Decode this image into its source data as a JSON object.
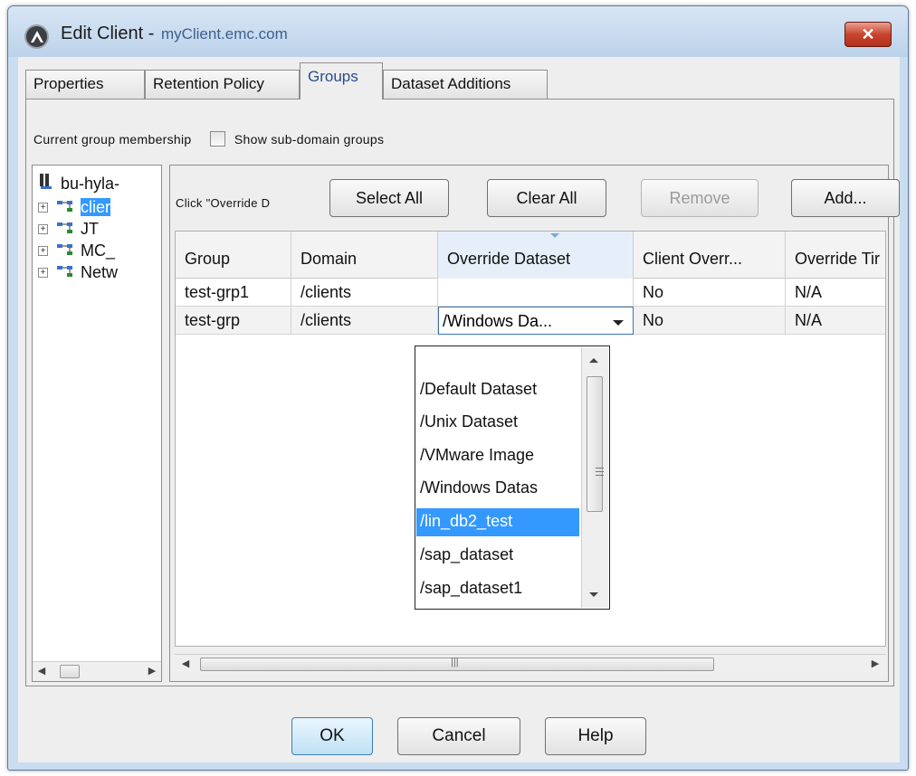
{
  "window": {
    "title": "Edit Client -",
    "subtitle": "myClient.emc.com",
    "close_label": "✕"
  },
  "tabs": [
    {
      "label": "Properties",
      "active": false
    },
    {
      "label": "Retention Policy",
      "active": false
    },
    {
      "label": "Groups",
      "active": true
    },
    {
      "label": "Dataset Additions",
      "active": false
    }
  ],
  "membership": {
    "label": "Current group membership",
    "show_subdomain_label": "Show sub-domain groups",
    "show_subdomain_checked": false
  },
  "tree": {
    "items": [
      {
        "label": "bu-hyla-"
      },
      {
        "label": "clier"
      },
      {
        "label": "JT"
      },
      {
        "label": "MC_"
      },
      {
        "label": "Netw"
      }
    ]
  },
  "toolbar": {
    "hint": "Click \"Override D",
    "select_all": "Select All",
    "clear_all": "Clear All",
    "remove": "Remove",
    "add": "Add..."
  },
  "table": {
    "columns": [
      "Group",
      "Domain",
      "Override Dataset",
      "Client Overr...",
      "Override Tir"
    ],
    "rows": [
      {
        "group": "test-grp1",
        "domain": "/clients",
        "override_dataset": "",
        "client_override": "No",
        "override_time": "N/A"
      },
      {
        "group": "test-grp",
        "domain": "/clients",
        "override_dataset": "/Windows Da...",
        "client_override": "No",
        "override_time": "N/A"
      }
    ]
  },
  "dropdown": {
    "options": [
      "/Default Dataset",
      "/Unix Dataset",
      "/VMware Image",
      "/Windows Datas",
      "/lin_db2_test",
      "/sap_dataset",
      "/sap_dataset1"
    ],
    "highlighted_index": 4
  },
  "footer": {
    "ok": "OK",
    "cancel": "Cancel",
    "help": "Help"
  },
  "colors": {
    "selection": "#3399ff",
    "frame": "#c9dcf0",
    "close": "#c8452e"
  }
}
